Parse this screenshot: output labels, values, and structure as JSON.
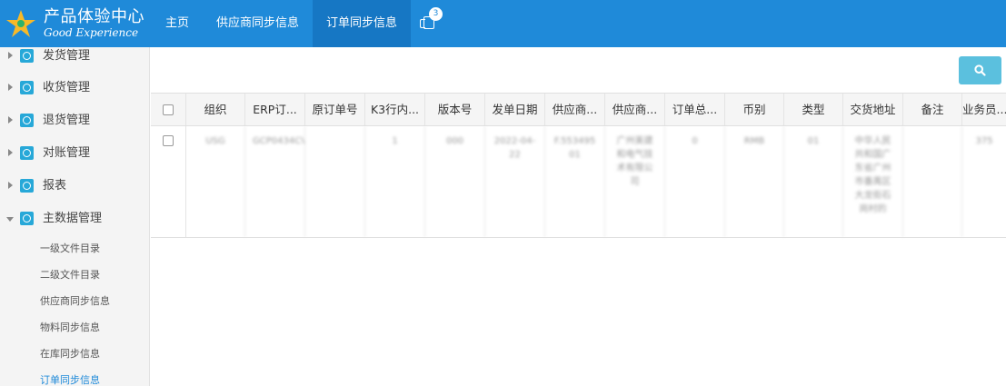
{
  "header": {
    "logo_title": "产品体验中心",
    "logo_subtitle": "Good Experience",
    "nav": [
      "主页",
      "供应商同步信息",
      "订单同步信息"
    ],
    "active_nav": 2,
    "badge_count": "3",
    "colors": {
      "header": "#1f8ad9",
      "active_tab": "#1677c4",
      "accent": "#5bc0de"
    }
  },
  "sidebar": {
    "groups": [
      "发货管理",
      "收货管理",
      "退货管理",
      "对账管理",
      "报表",
      "主数据管理"
    ],
    "expanded": "主数据管理",
    "sub_items": [
      "一级文件目录",
      "二级文件目录",
      "供应商同步信息",
      "物料同步信息",
      "在库同步信息",
      "订单同步信息"
    ],
    "active_sub": "订单同步信息"
  },
  "toolbar": {
    "search_icon": "search-icon"
  },
  "table": {
    "columns": [
      "组织",
      "ERP订...",
      "原订单号",
      "K3行内...",
      "版本号",
      "发单日期",
      "供应商...",
      "供应商...",
      "订单总...",
      "币别",
      "类型",
      "交货地址",
      "备注",
      "业务员..."
    ],
    "rows": [
      [
        "USG",
        "GCP0434CV055",
        "",
        "1",
        "000",
        "2022-04-22",
        "F.55349501",
        "广州美建和电气技术有限公司",
        "0",
        "RMB",
        "01",
        "中华人民共和国广东省广州市番禺区大龙街石岗村的",
        "",
        "375"
      ]
    ]
  }
}
